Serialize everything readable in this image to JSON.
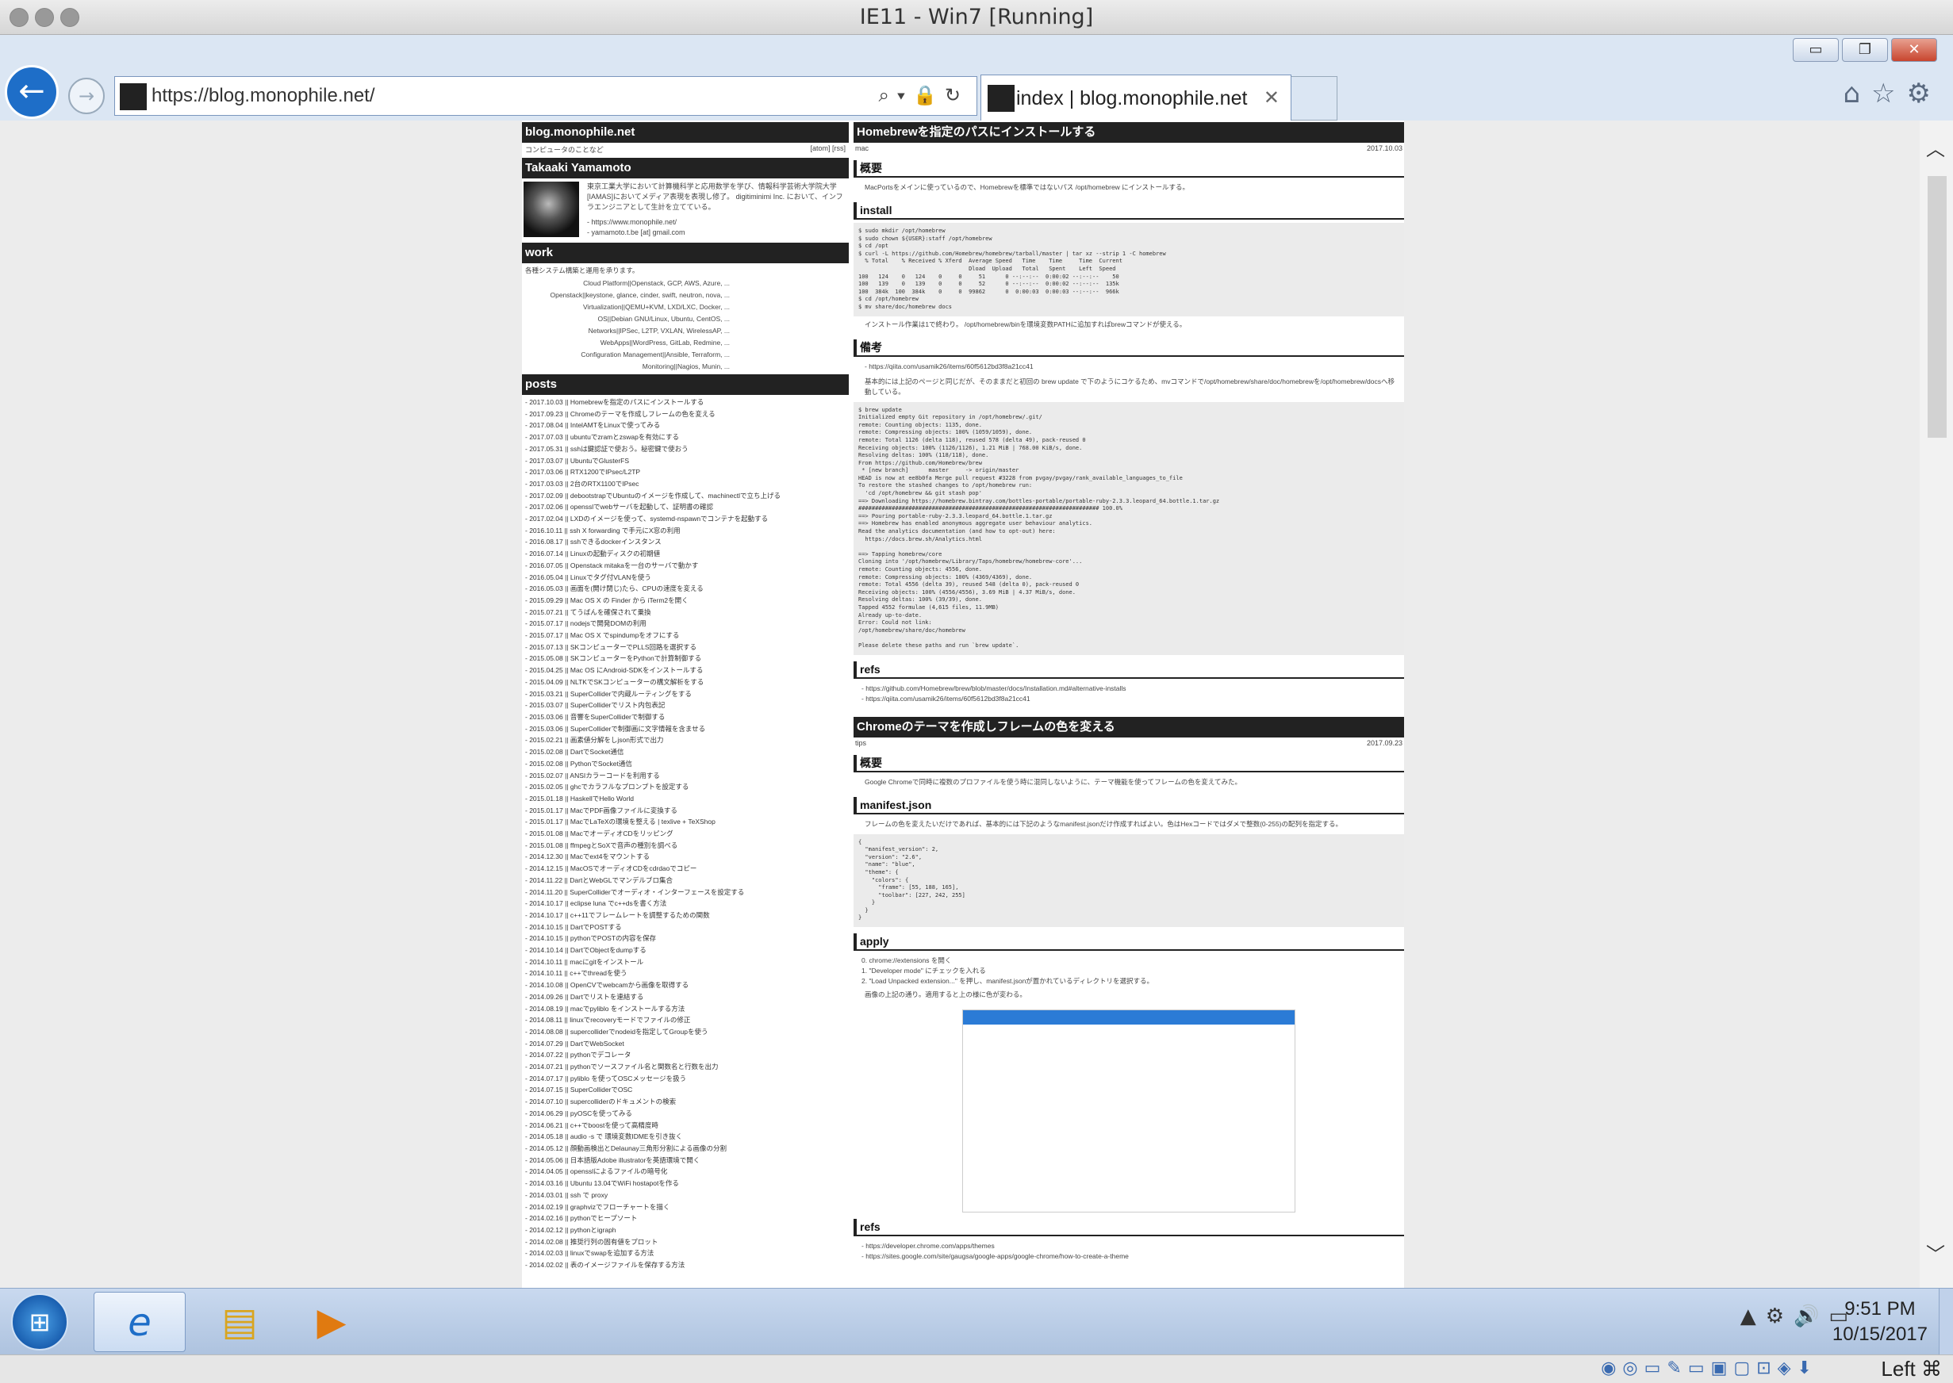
{
  "vm": {
    "title": "IE11 - Win7 [Running]",
    "host_key": "Left ⌘"
  },
  "window_buttons": [
    "▭",
    "❐",
    "✕"
  ],
  "nav": {
    "back": "←",
    "forward": "→"
  },
  "address": {
    "url": "https://blog.monophile.net/",
    "icons": "⌕▾🔒↻"
  },
  "tab": {
    "title": "index | blog.monophile.net",
    "close": "✕"
  },
  "toolbar_icons": "⌂☆⚙",
  "site": {
    "name": "blog.monophile.net",
    "tagline": "コンピュータのことなど",
    "feeds": "[atom] [rss]"
  },
  "author": {
    "name": "Takaaki Yamamoto",
    "bio": "東京工業大学において計算機科学と応用数学を学び、情報科学芸術大学院大学[IAMAS]においてメディア表現を表現し修了。 digitiminimi Inc. において、インフラエンジニアとして生計を立てている。",
    "links": [
      "- https://www.monophile.net/",
      "- yamamoto.t.be [at] gmail.com"
    ]
  },
  "work": {
    "heading": "work",
    "intro": "各種システム構築と運用を承ります。",
    "items": [
      "Cloud Platform||Openstack, GCP, AWS, Azure, ...",
      "Openstack||keystone, glance, cinder, swift, neutron, nova, ...",
      "Virtualization||QEMU+KVM, LXD/LXC, Docker, ...",
      "OS||Debian GNU/Linux, Ubuntu, CentOS, ...",
      "Networks||IPSec, L2TP, VXLAN, WirelessAP, ...",
      "WebApps||WordPress, GitLab, Redmine, ...",
      "Configuration Management||Ansible, Terraform, ...",
      "Monitoring||Nagios, Munin, ..."
    ]
  },
  "posts": {
    "heading": "posts",
    "items": [
      "- 2017.10.03 || Homebrewを指定のパスにインストールする",
      "- 2017.09.23 || Chromeのテーマを作成しフレームの色を変える",
      "- 2017.08.04 || IntelAMTをLinuxで使ってみる",
      "- 2017.07.03 || ubuntuでzramとzswapを有効にする",
      "- 2017.05.31 || sshは鍵認証で使おう。秘密鍵で使おう",
      "- 2017.03.07 || UbuntuでGlusterFS",
      "- 2017.03.06 || RTX1200でIPsec/L2TP",
      "- 2017.03.03 || 2台のRTX1100でIPsec",
      "- 2017.02.09 || debootstrapでUbuntuのイメージを作成して、machinectlで立ち上げる",
      "- 2017.02.06 || opensslでwebサーバを起動して、証明書の確認",
      "- 2017.02.04 || LXDのイメージを使って、systemd-nspawnでコンテナを起動する",
      "- 2016.10.11 || ssh X forwarding で手元にX窓の利用",
      "- 2016.08.17 || sshできるdockerインスタンス",
      "- 2016.07.14 || Linuxの起動ディスクの初期値",
      "- 2016.07.05 || Openstack mitakaを一台のサーバで動かす",
      "- 2016.05.04 || Linuxでタグ付VLANを使う",
      "- 2016.05.03 || 画面を(開け閉じ)たら、CPUの速度を変える",
      "- 2015.09.29 || Mac OS X の Finder から iTerm2を開く",
      "- 2015.07.21 || てうばんを確保されて乗換",
      "- 2015.07.17 || nodejsで開発DOMの利用",
      "- 2015.07.17 || Mac OS X でspindumpをオフにする",
      "- 2015.07.13 || SKコンピューターでPLLS回路を選択する",
      "- 2015.05.08 || SKコンピューターをPythonで計算制御する",
      "- 2015.04.25 || Mac OS にAndroid-SDKをインストールする",
      "- 2015.04.09 || NLTKでSKコンピューターの構文解析をする",
      "- 2015.03.21 || SuperColliderで内蔵ルーティングをする",
      "- 2015.03.07 || SuperColliderでリスト内包表記",
      "- 2015.03.06 || 音響をSuperColliderで制御する",
      "- 2015.03.06 || SuperColliderで制御画に文字情報を含ませる",
      "- 2015.02.21 || 画素値分解をしjson形式で出力",
      "- 2015.02.08 || DartでSocket通信",
      "- 2015.02.08 || PythonでSocket通信",
      "- 2015.02.07 || ANSIカラーコードを利用する",
      "- 2015.02.05 || ghcでカラフルなプロンプトを設定する",
      "- 2015.01.18 || HaskellでHello World",
      "- 2015.01.17 || MacでPDF画像ファイルに変換する",
      "- 2015.01.17 || MacでLaTeXの環境を整える | texlive + TeXShop",
      "- 2015.01.08 || MacでオーディオCDをリッピング",
      "- 2015.01.08 || ffmpegとSoXで音声の種別を調べる",
      "- 2014.12.30 || Macでext4をマウントする",
      "- 2014.12.15 || MacOSでオーディオCDをcdrdaoでコピー",
      "- 2014.11.22 || DartとWebGLでマンデルブロ集合",
      "- 2014.11.20 || SuperColliderでオーディオ・インターフェースを設定する",
      "- 2014.10.17 || eclipse luna でc++dsを書く方法",
      "- 2014.10.17 || c++11でフレームレートを調整するための関数",
      "- 2014.10.15 || DartでPOSTする",
      "- 2014.10.15 || pythonでPOSTの内容を保存",
      "- 2014.10.14 || DartでObjectをdumpする",
      "- 2014.10.11 || macにgitをインストール",
      "- 2014.10.11 || c++でthreadを使う",
      "- 2014.10.08 || OpenCVでwebcamから画像を取得する",
      "- 2014.09.26 || Dartでリストを連結する",
      "- 2014.08.19 || macでpyliblo をインストールする方法",
      "- 2014.08.11 || linuxでrecoveryモードでファイルの修正",
      "- 2014.08.08 || supercolliderでnodeidを指定してGroupを使う",
      "- 2014.07.29 || DartでWebSocket",
      "- 2014.07.22 || pythonでデコレータ",
      "- 2014.07.21 || pythonでソースファイル名と関数名と行数を出力",
      "- 2014.07.17 || pyliblo を使ってOSCメッセージを扱う",
      "- 2014.07.15 || SuperColliderでOSC",
      "- 2014.07.10 || supercolliderのドキュメントの検索",
      "- 2014.06.29 || pyOSCを使ってみる",
      "- 2014.06.21 || c++でboostを使って高精度時",
      "- 2014.05.18 || audio -s で 環境変数IDMEを引き抜く",
      "- 2014.05.12 || 顔動画検出とDelaunay三角形分割による画像の分割",
      "- 2014.05.06 || 日本語版Adobe illustratorを英語環境で開く",
      "- 2014.04.05 || opensslによるファイルの暗号化",
      "- 2014.03.16 || Ubuntu 13.04でWiFi hostapotを作る",
      "- 2014.03.01 || ssh で proxy",
      "- 2014.02.19 || graphvizでフローチャートを描く",
      "- 2014.02.16 || pythonでヒープソート",
      "- 2014.02.12 || pythonとigraph",
      "- 2014.02.08 || 推奨行列の固有値をプロット",
      "- 2014.02.03 || linuxでswapを追加する方法",
      "- 2014.02.02 || 表のイメージファイルを保存する方法"
    ]
  },
  "article1": {
    "title": "Homebrewを指定のパスにインストールする",
    "tag": "mac",
    "date": "2017.10.03",
    "h_overview": "概要",
    "overview": "MacPortsをメインに使っているので、Homebrewを標準ではないパス /opt/homebrew にインストールする。",
    "h_install": "install",
    "code_install": "$ sudo mkdir /opt/homebrew\n$ sudo chown ${USER}:staff /opt/homebrew\n$ cd /opt\n$ curl -L https://github.com/Homebrew/homebrew/tarball/master | tar xz --strip 1 -C homebrew\n  % Total    % Received % Xferd  Average Speed   Time    Time     Time  Current\n                                 Dload  Upload   Total   Spent    Left  Speed\n100   124    0   124    0     0     51      0 --:--:--  0:00:02 --:--:--    50\n100   139    0   139    0     0     52      0 --:--:--  0:00:02 --:--:--  135k\n100  384k  100  384k    0     0  99862      0  0:00:03  0:00:03 --:--:--  966k\n$ cd /opt/homebrew\n$ mv share/doc/homebrew docs",
    "install_note": "インストール作業は1で終わり。 /opt/homebrew/binを環境変数PATHに追加すればbrewコマンドが使える。",
    "h_notes": "備考",
    "notes_link": "- https://qiita.com/usamik26/items/60f5612bd3f8a21cc41",
    "notes_text": "基本的には上記のページと同じだが、そのままだと初回の brew update で下のようにコケるため、mvコマンドで/opt/homebrew/share/doc/homebrewを/opt/homebrew/docsへ移動している。",
    "code_update": "$ brew update\nInitialized empty Git repository in /opt/homebrew/.git/\nremote: Counting objects: 1135, done.\nremote: Compressing objects: 100% (1059/1059), done.\nremote: Total 1126 (delta 118), reused 578 (delta 49), pack-reused 0\nReceiving objects: 100% (1126/1126), 1.21 MiB | 768.00 KiB/s, done.\nResolving deltas: 100% (118/118), done.\nFrom https://github.com/Homebrew/brew\n * [new branch]      master     -> origin/master\nHEAD is now at ee8b0fa Merge pull request #3228 from pvgay/pvgay/rank_available_languages_to_file\nTo restore the stashed changes to /opt/homebrew run:\n  'cd /opt/homebrew && git stash pop'\n==> Downloading https://homebrew.bintray.com/bottles-portable/portable-ruby-2.3.3.leopard_64.bottle.1.tar.gz\n######################################################################## 100.0%\n==> Pouring portable-ruby-2.3.3.leopard_64.bottle.1.tar.gz\n==> Homebrew has enabled anonymous aggregate user behaviour analytics.\nRead the analytics documentation (and how to opt-out) here:\n  https://docs.brew.sh/Analytics.html\n\n==> Tapping homebrew/core\nCloning into '/opt/homebrew/Library/Taps/homebrew/homebrew-core'...\nremote: Counting objects: 4556, done.\nremote: Compressing objects: 100% (4369/4369), done.\nremote: Total 4556 (delta 39), reused 548 (delta 0), pack-reused 0\nReceiving objects: 100% (4556/4556), 3.69 MiB | 4.37 MiB/s, done.\nResolving deltas: 100% (39/39), done.\nTapped 4552 formulae (4,615 files, 11.9MB)\nAlready up-to-date.\nError: Could not link:\n/opt/homebrew/share/doc/homebrew\n\nPlease delete these paths and run `brew update`.",
    "h_refs": "refs",
    "refs": [
      "- https://github.com/Homebrew/brew/blob/master/docs/Installation.md#alternative-installs",
      "- https://qiita.com/usamik26/items/60f5612bd3f8a21cc41"
    ]
  },
  "article2": {
    "title": "Chromeのテーマを作成しフレームの色を変える",
    "tag": "tips",
    "date": "2017.09.23",
    "h_overview": "概要",
    "overview": "Google Chromeで同時に複数のプロファイルを使う時に混同しないように、テーマ機能を使ってフレームの色を変えてみた。",
    "h_manifest": "manifest.json",
    "manifest_text": "フレームの色を変えたいだけであれば、基本的には下記のようなmanifest.jsonだけ作成すればよい。色はHexコードではダメで整数(0-255)の配列を指定する。",
    "code_manifest": "{\n  \"manifest_version\": 2,\n  \"version\": \"2.6\",\n  \"name\": \"blue\",\n  \"theme\": {\n    \"colors\": {\n      \"frame\": [55, 188, 165],\n      \"toolbar\": [227, 242, 255]\n    }\n  }\n}",
    "h_apply": "apply",
    "apply_steps": [
      "0. chrome://extensions を開く",
      "1. \"Developer mode\" にチェックを入れる",
      "2. \"Load Unpacked extension...\" を押し、manifest.jsonが置かれているディレクトリを選択する。"
    ],
    "apply_note": "画像の上記の通り。適用すると上の様に色が変わる。",
    "h_refs": "refs",
    "refs": [
      "- https://developer.chrome.com/apps/themes",
      "- https://sites.google.com/site/gaugsa/google-apps/google-chrome/how-to-create-a-theme"
    ]
  },
  "scroll": {
    "up": "︿",
    "down": "﹀"
  },
  "taskbar": {
    "start": "⊞",
    "ie": "e",
    "explorer": "▤",
    "media": "▶",
    "tray": "▲⚙🔊▭",
    "time": "9:51 PM",
    "date": "10/15/2017"
  },
  "vmbar_icons": "◉◎▭✎▭▣▢⊡◈⬇"
}
